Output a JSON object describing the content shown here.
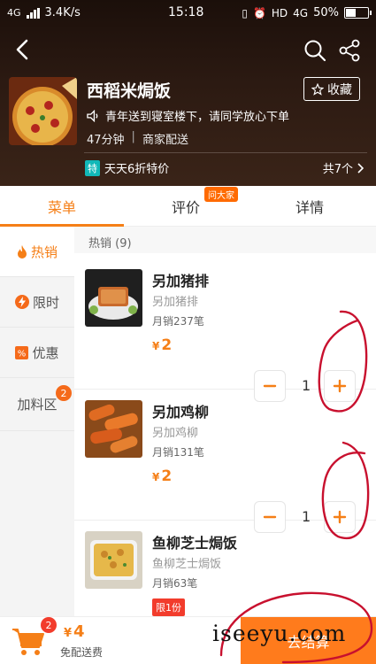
{
  "status_bar": {
    "network": "4G",
    "speed": "3.4K/s",
    "time": "15:18",
    "hd": "HD",
    "network2": "4G",
    "battery": "50%"
  },
  "shop": {
    "name": "西稻米焗饭",
    "favorite_label": "收藏",
    "notice": "青年送到寝室楼下，请同学放心下单",
    "delivery_time": "47分钟",
    "delivery_type": "商家配送",
    "promo_badge": "特",
    "promo_text": "天天6折特价",
    "promo_count": "共7个"
  },
  "tabs": [
    {
      "label": "菜单"
    },
    {
      "label": "评价"
    },
    {
      "label": "详情"
    }
  ],
  "tab_badge": "问大家",
  "sidebar": {
    "items": [
      {
        "label": "热销"
      },
      {
        "label": "限时"
      },
      {
        "label": "优惠"
      },
      {
        "label": "加料区"
      }
    ],
    "addon_badge": "2"
  },
  "section": {
    "title": "热销 (9)"
  },
  "items": [
    {
      "name": "另加猪排",
      "desc": "另加猪排",
      "sales": "月销237笔",
      "currency": "¥",
      "price": "2",
      "qty": "1"
    },
    {
      "name": "另加鸡柳",
      "desc": "另加鸡柳",
      "sales": "月销131笔",
      "currency": "¥",
      "price": "2",
      "qty": "1"
    },
    {
      "name": "鱼柳芝士焗饭",
      "desc": "鱼柳芝士焗饭",
      "sales": "月销63笔",
      "limit": "限1份"
    }
  ],
  "cart": {
    "badge": "2",
    "currency": "¥",
    "total": "4",
    "delivery": "免配送费",
    "checkout_label": "去结算"
  },
  "watermark": "iseeyu.com",
  "colors": {
    "accent": "#f57f17",
    "header_bg": "#2c1a12",
    "badge_red": "#f23c2c",
    "annotation": "#c8102e"
  }
}
